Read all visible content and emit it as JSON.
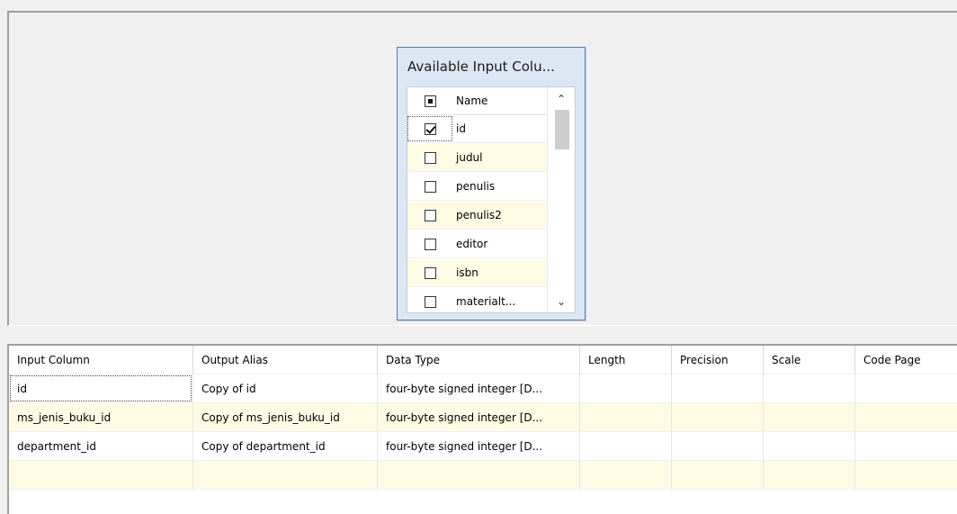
{
  "available_columns": {
    "title": "Available Input Colu...",
    "header_label": "Name",
    "header_check": "partial",
    "items": [
      {
        "name": "id",
        "checked": true
      },
      {
        "name": "judul",
        "checked": false
      },
      {
        "name": "penulis",
        "checked": false
      },
      {
        "name": "penulis2",
        "checked": false
      },
      {
        "name": "editor",
        "checked": false
      },
      {
        "name": "isbn",
        "checked": false
      },
      {
        "name": "materialt...",
        "checked": false
      }
    ],
    "scrollbar": {
      "up_icon": "chevron-up-icon",
      "down_icon": "chevron-down-icon"
    }
  },
  "grid": {
    "headers": [
      "Input Column",
      "Output Alias",
      "Data Type",
      "Length",
      "Precision",
      "Scale",
      "Code Page"
    ],
    "rows": [
      [
        "id",
        "Copy of id",
        "four-byte signed integer [D...",
        "",
        "",
        "",
        ""
      ],
      [
        "ms_jenis_buku_id",
        "Copy of ms_jenis_buku_id",
        "four-byte signed integer [D...",
        "",
        "",
        "",
        ""
      ],
      [
        "department_id",
        "Copy of department_id",
        "four-byte signed integer [D...",
        "",
        "",
        "",
        ""
      ],
      [
        "",
        "",
        "",
        "",
        "",
        "",
        ""
      ]
    ]
  },
  "colors": {
    "background": "#f0f0f0",
    "panel_bg": "#dce7f4",
    "panel_border": "#5b7aa8",
    "alt_row": "#fffbe5"
  }
}
